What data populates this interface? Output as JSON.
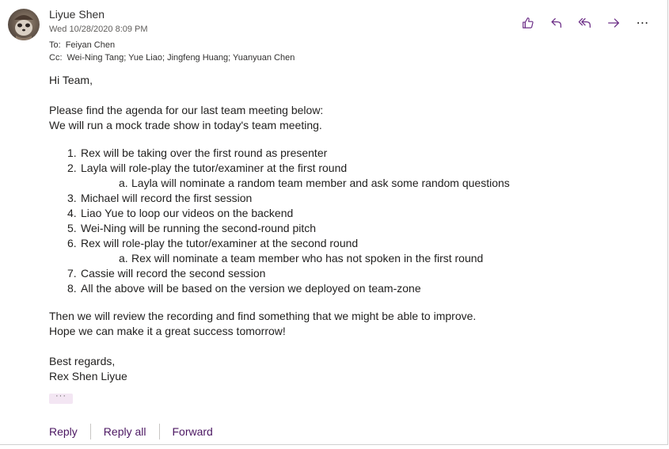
{
  "message": {
    "sender": "Liyue Shen",
    "date": "Wed 10/28/2020 8:09 PM",
    "to_label": "To:",
    "to": "Feiyan Chen",
    "cc_label": "Cc:",
    "cc": "Wei-Ning Tang; Yue Liao; Jingfeng Huang; Yuanyuan Chen"
  },
  "actions": {
    "like_icon": "thumbs-up-icon",
    "reply_icon": "reply-icon",
    "reply_all_icon": "reply-all-icon",
    "forward_icon": "forward-icon",
    "more": "⋯",
    "accent_color": "#6b2d86"
  },
  "body": {
    "greeting": "Hi Team,",
    "intro1": "Please find the agenda for our last team meeting below:",
    "intro2": "We will run a mock trade show in today's team meeting.",
    "items": [
      {
        "num": "1.",
        "text": "Rex will be taking over the first round as presenter"
      },
      {
        "num": "2.",
        "text": "Layla will role-play the tutor/examiner at the first round"
      },
      {
        "num": "a.",
        "text": "Layla will nominate a random team member and ask some random questions"
      },
      {
        "num": "3.",
        "text": "Michael will record the first session"
      },
      {
        "num": "4.",
        "text": "Liao Yue to loop our videos on the backend"
      },
      {
        "num": "5.",
        "text": "Wei-Ning will be running the second-round pitch"
      },
      {
        "num": "6.",
        "text": "Rex will role-play the tutor/examiner at the second round"
      },
      {
        "num": "a.",
        "text": "Rex will nominate a team member who has not spoken in the first round"
      },
      {
        "num": "7.",
        "text": "Cassie will record the second session"
      },
      {
        "num": "8.",
        "text": "All the above will be based on the version we deployed on team-zone"
      }
    ],
    "outro1": "Then we will review the recording and find something that we might be able to improve.",
    "outro2": "Hope we can make it a great success tomorrow!",
    "closing": "Best regards,",
    "signature": "Rex Shen Liyue",
    "show_more": "···"
  },
  "reply_bar": {
    "reply": "Reply",
    "reply_all": "Reply all",
    "forward": "Forward"
  }
}
